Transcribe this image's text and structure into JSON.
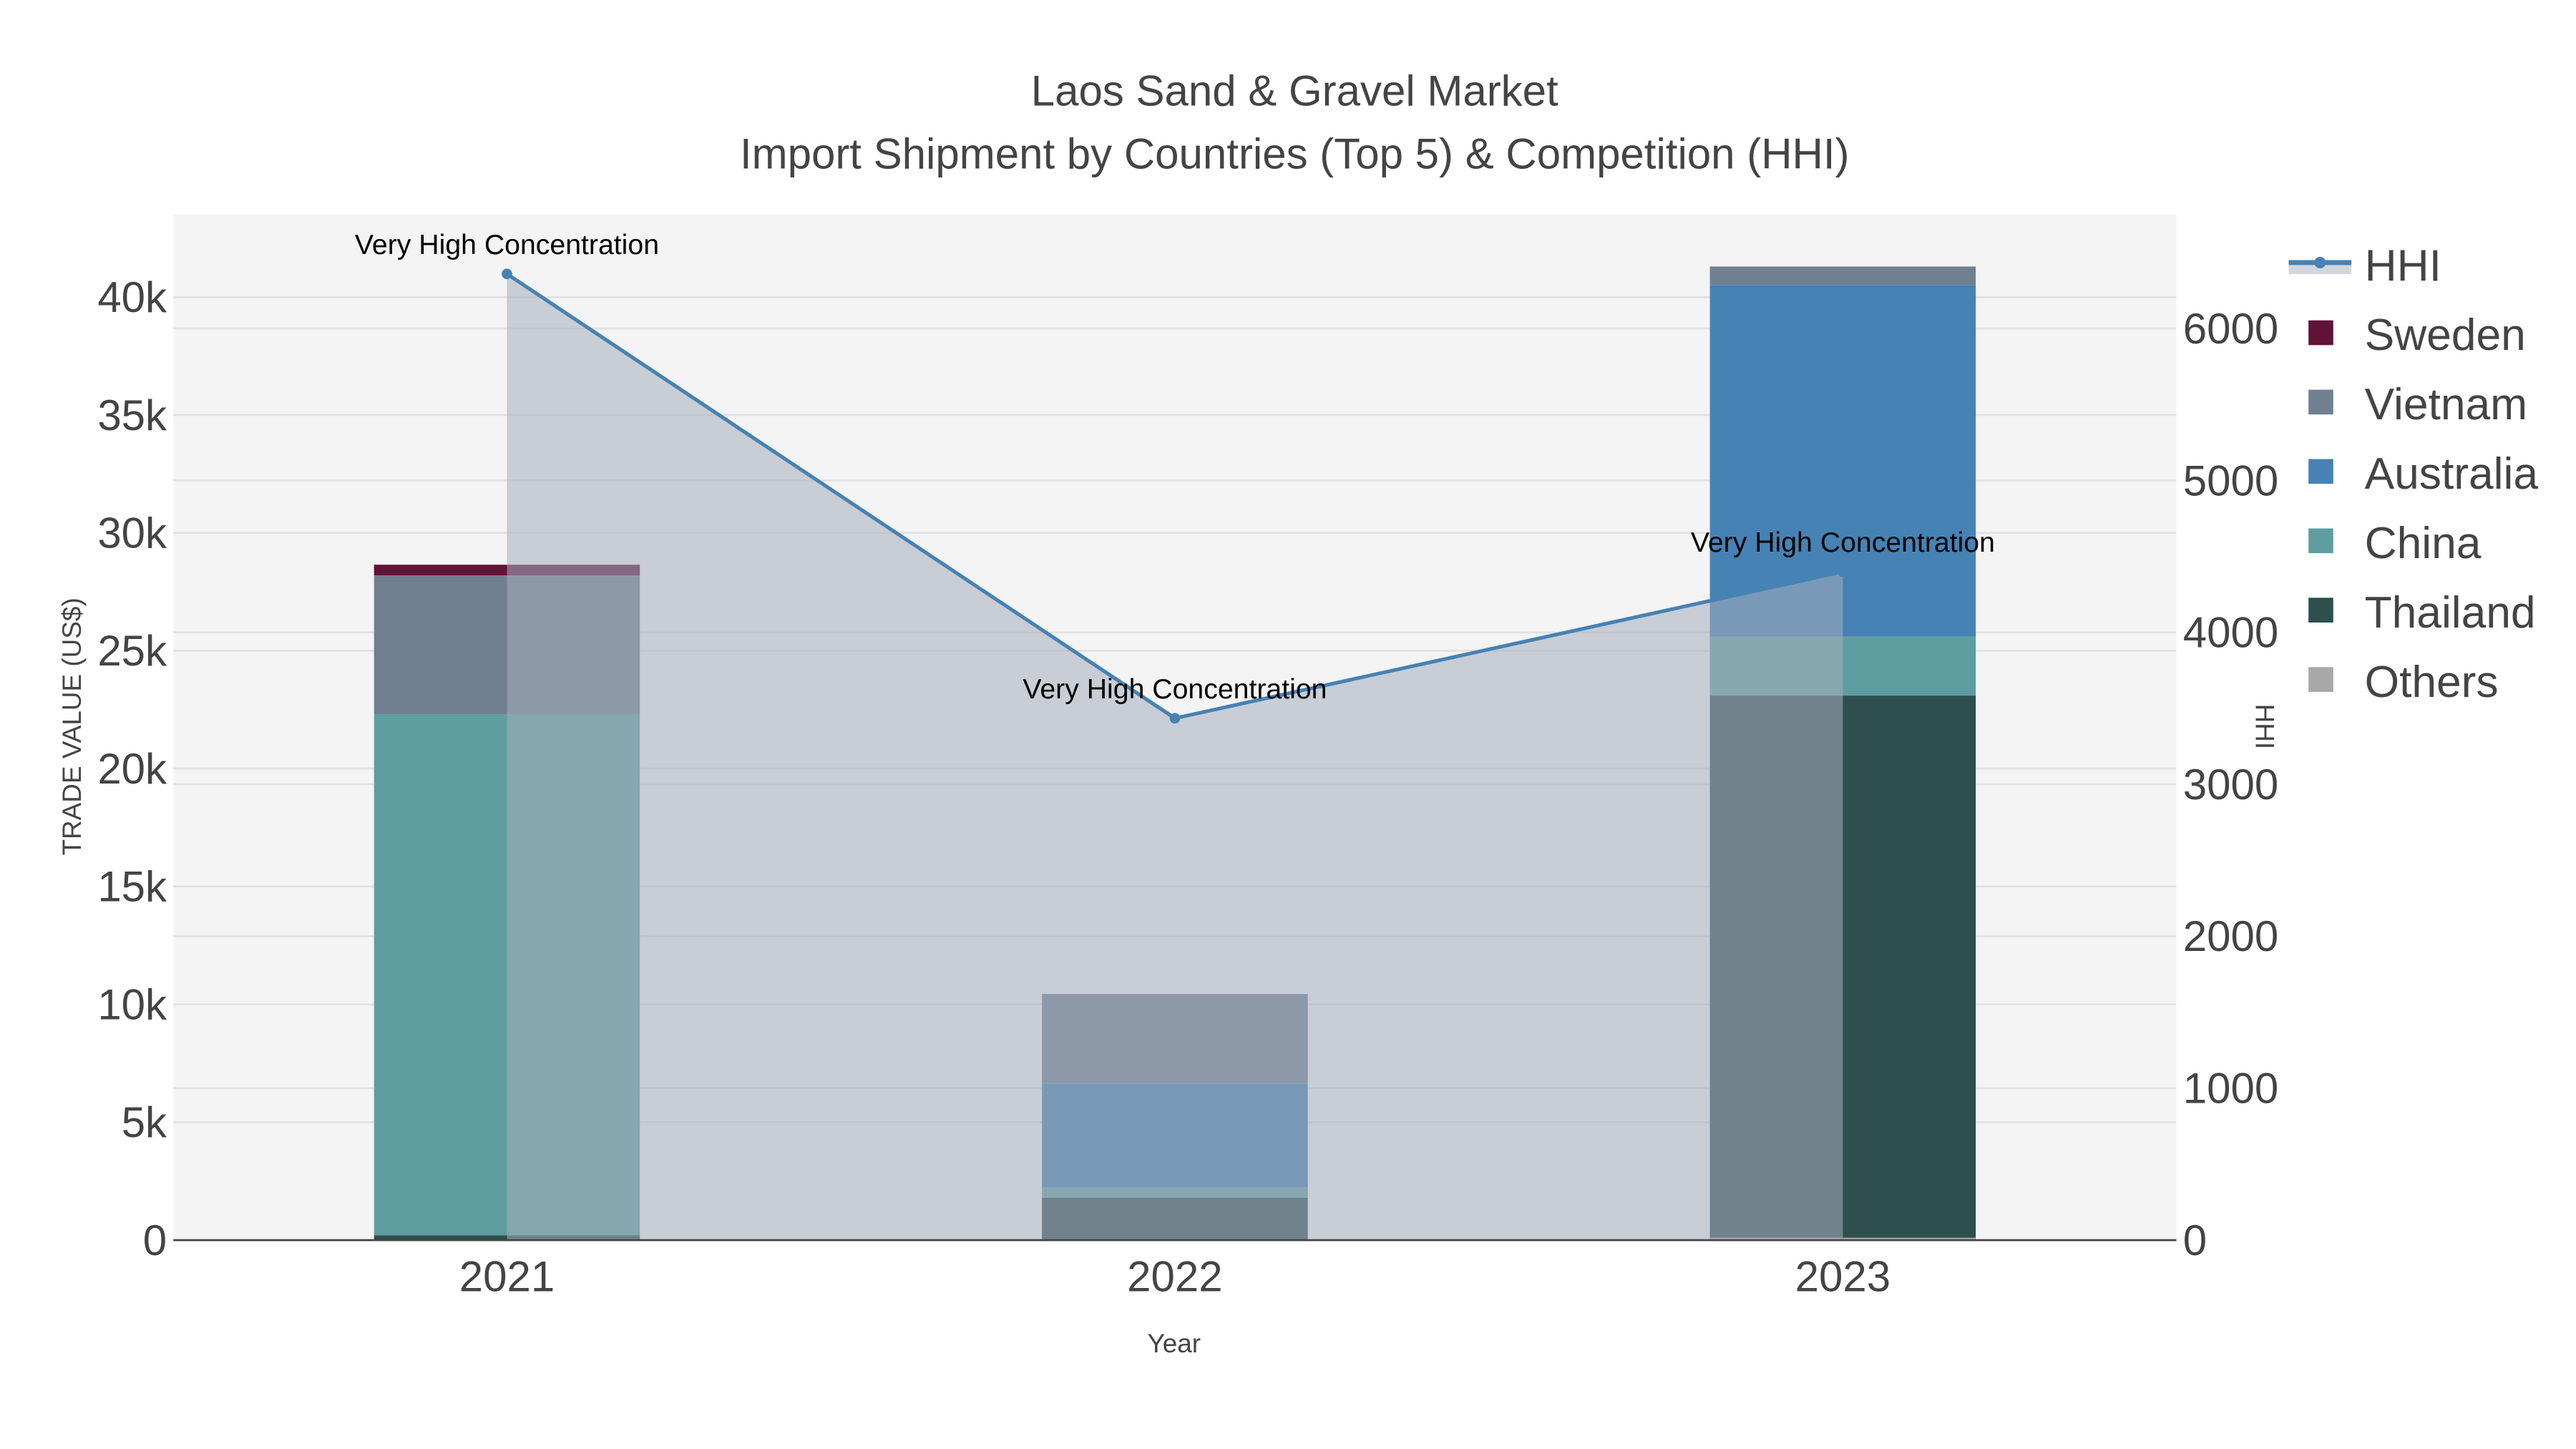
{
  "chart_data": {
    "type": "bar",
    "barmode": "stack",
    "title": "Laos Sand & Gravel Market",
    "subtitle": "Import Shipment by Countries (Top 5) & Competition (HHI)",
    "xlabel": "Year",
    "ylabel": "TRADE VALUE (US$)",
    "y2label": "HHI",
    "categories": [
      "2021",
      "2022",
      "2023"
    ],
    "ylim": [
      0,
      43500
    ],
    "y2lim": [
      0,
      6750
    ],
    "yticks": [
      0,
      5000,
      10000,
      15000,
      20000,
      25000,
      30000,
      35000,
      40000
    ],
    "ytick_labels": [
      "0",
      "5k",
      "10k",
      "15k",
      "20k",
      "25k",
      "30k",
      "35k",
      "40k"
    ],
    "y2ticks": [
      0,
      1000,
      2000,
      3000,
      4000,
      5000,
      6000
    ],
    "y2tick_labels": [
      "0",
      "1000",
      "2000",
      "3000",
      "4000",
      "5000",
      "6000"
    ],
    "grid": true,
    "legend_position": "right",
    "series": [
      {
        "name": "Others",
        "color": "#a9a9a9",
        "values": [
          0,
          0,
          100
        ]
      },
      {
        "name": "Thailand",
        "color": "#2f4f4f",
        "values": [
          200,
          1800,
          23000
        ]
      },
      {
        "name": "China",
        "color": "#5f9ea0",
        "values": [
          22100,
          440,
          2500
        ]
      },
      {
        "name": "Australia",
        "color": "#4682b4",
        "values": [
          0,
          4400,
          14900
        ]
      },
      {
        "name": "Vietnam",
        "color": "#708090",
        "values": [
          5900,
          3800,
          800
        ]
      },
      {
        "name": "Sweden",
        "color": "#611237",
        "values": [
          450,
          0,
          0
        ]
      }
    ],
    "hhi": {
      "name": "HHI",
      "color": "#4682b4",
      "values": [
        6360,
        3435,
        4400
      ],
      "annotations": [
        "Very High Concentration",
        "Very High Concentration",
        "Very High Concentration"
      ]
    },
    "legend_order": [
      "HHI",
      "Sweden",
      "Vietnam",
      "Australia",
      "China",
      "Thailand",
      "Others"
    ]
  }
}
